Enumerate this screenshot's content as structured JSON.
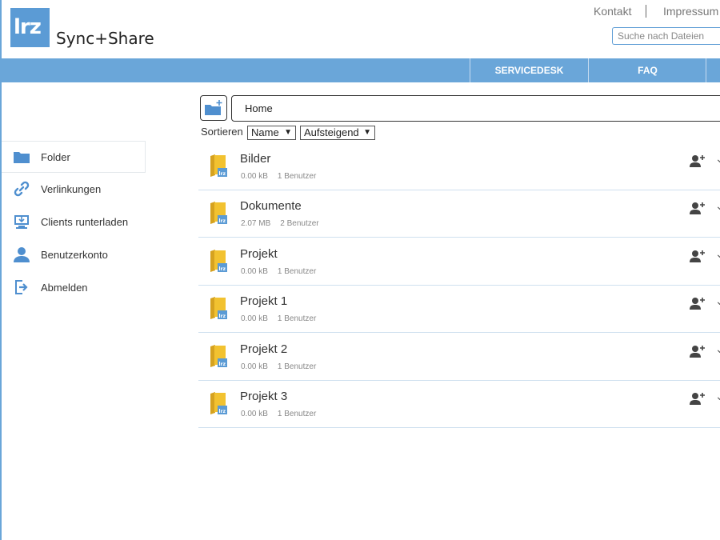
{
  "header": {
    "logo_text": "lrz",
    "brand": "Sync+Share",
    "links": [
      "Kontakt",
      "Impressum"
    ],
    "search_placeholder": "Suche nach Dateien"
  },
  "nav": {
    "items": [
      "SERVICEDESK",
      "FAQ"
    ]
  },
  "sidebar": {
    "items": [
      {
        "label": "Folder",
        "icon": "folder-icon"
      },
      {
        "label": "Verlinkungen",
        "icon": "link-icon"
      },
      {
        "label": "Clients runterladen",
        "icon": "monitor-download-icon"
      },
      {
        "label": "Benutzerkonto",
        "icon": "user-icon"
      },
      {
        "label": "Abmelden",
        "icon": "logout-icon"
      }
    ]
  },
  "breadcrumb": {
    "current": "Home"
  },
  "sort": {
    "label": "Sortieren",
    "field": "Name",
    "order": "Aufsteigend"
  },
  "files": [
    {
      "name": "Bilder",
      "size": "0.00 kB",
      "users": "1 Benutzer"
    },
    {
      "name": "Dokumente",
      "size": "2.07 MB",
      "users": "2 Benutzer"
    },
    {
      "name": "Projekt",
      "size": "0.00 kB",
      "users": "1 Benutzer"
    },
    {
      "name": "Projekt 1",
      "size": "0.00 kB",
      "users": "1 Benutzer"
    },
    {
      "name": "Projekt 2",
      "size": "0.00 kB",
      "users": "1 Benutzer"
    },
    {
      "name": "Projekt 3",
      "size": "0.00 kB",
      "users": "1 Benutzer"
    }
  ],
  "colors": {
    "accent": "#6aa6d9",
    "logo": "#5b9bd5",
    "folder": "#f2c230"
  }
}
